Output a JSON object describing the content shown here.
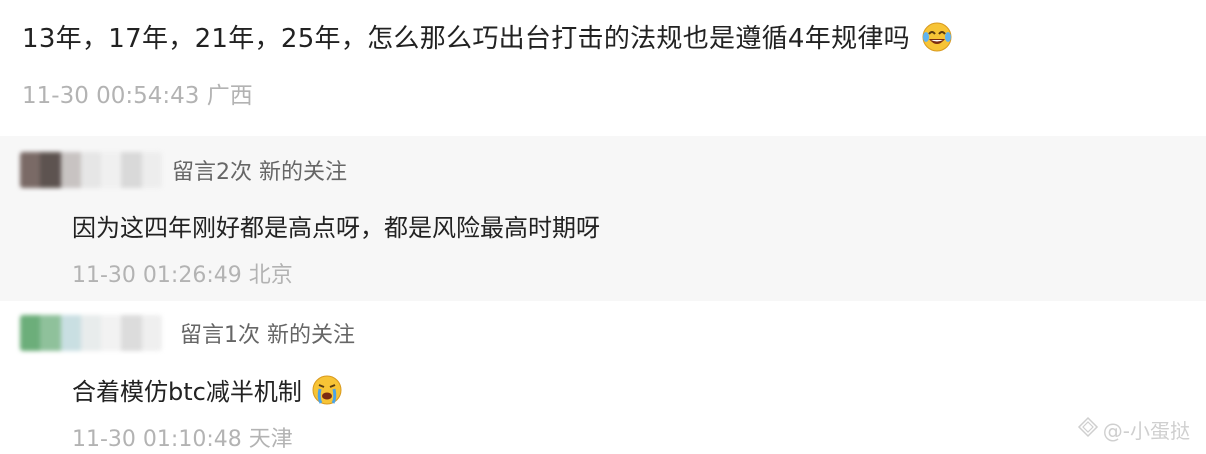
{
  "main_comment": {
    "text": "13年，17年，21年，25年，怎么那么巧出台打击的法规也是遵循4年规律吗",
    "emoji": "laughing-tears-icon",
    "timestamp": "11-30 00:54:43",
    "location": "广西"
  },
  "replies": [
    {
      "tag": "留言2次 新的关注",
      "text": "因为这四年刚好都是高点呀，都是风险最高时期呀",
      "timestamp": "11-30 01:26:49",
      "location": "北京"
    },
    {
      "tag": "留言1次 新的关注",
      "text": "合着模仿btc减半机制",
      "emoji": "crying-face-icon",
      "timestamp": "11-30 01:10:48",
      "location": "天津"
    }
  ],
  "watermark": {
    "text": "@-小蛋挞"
  }
}
